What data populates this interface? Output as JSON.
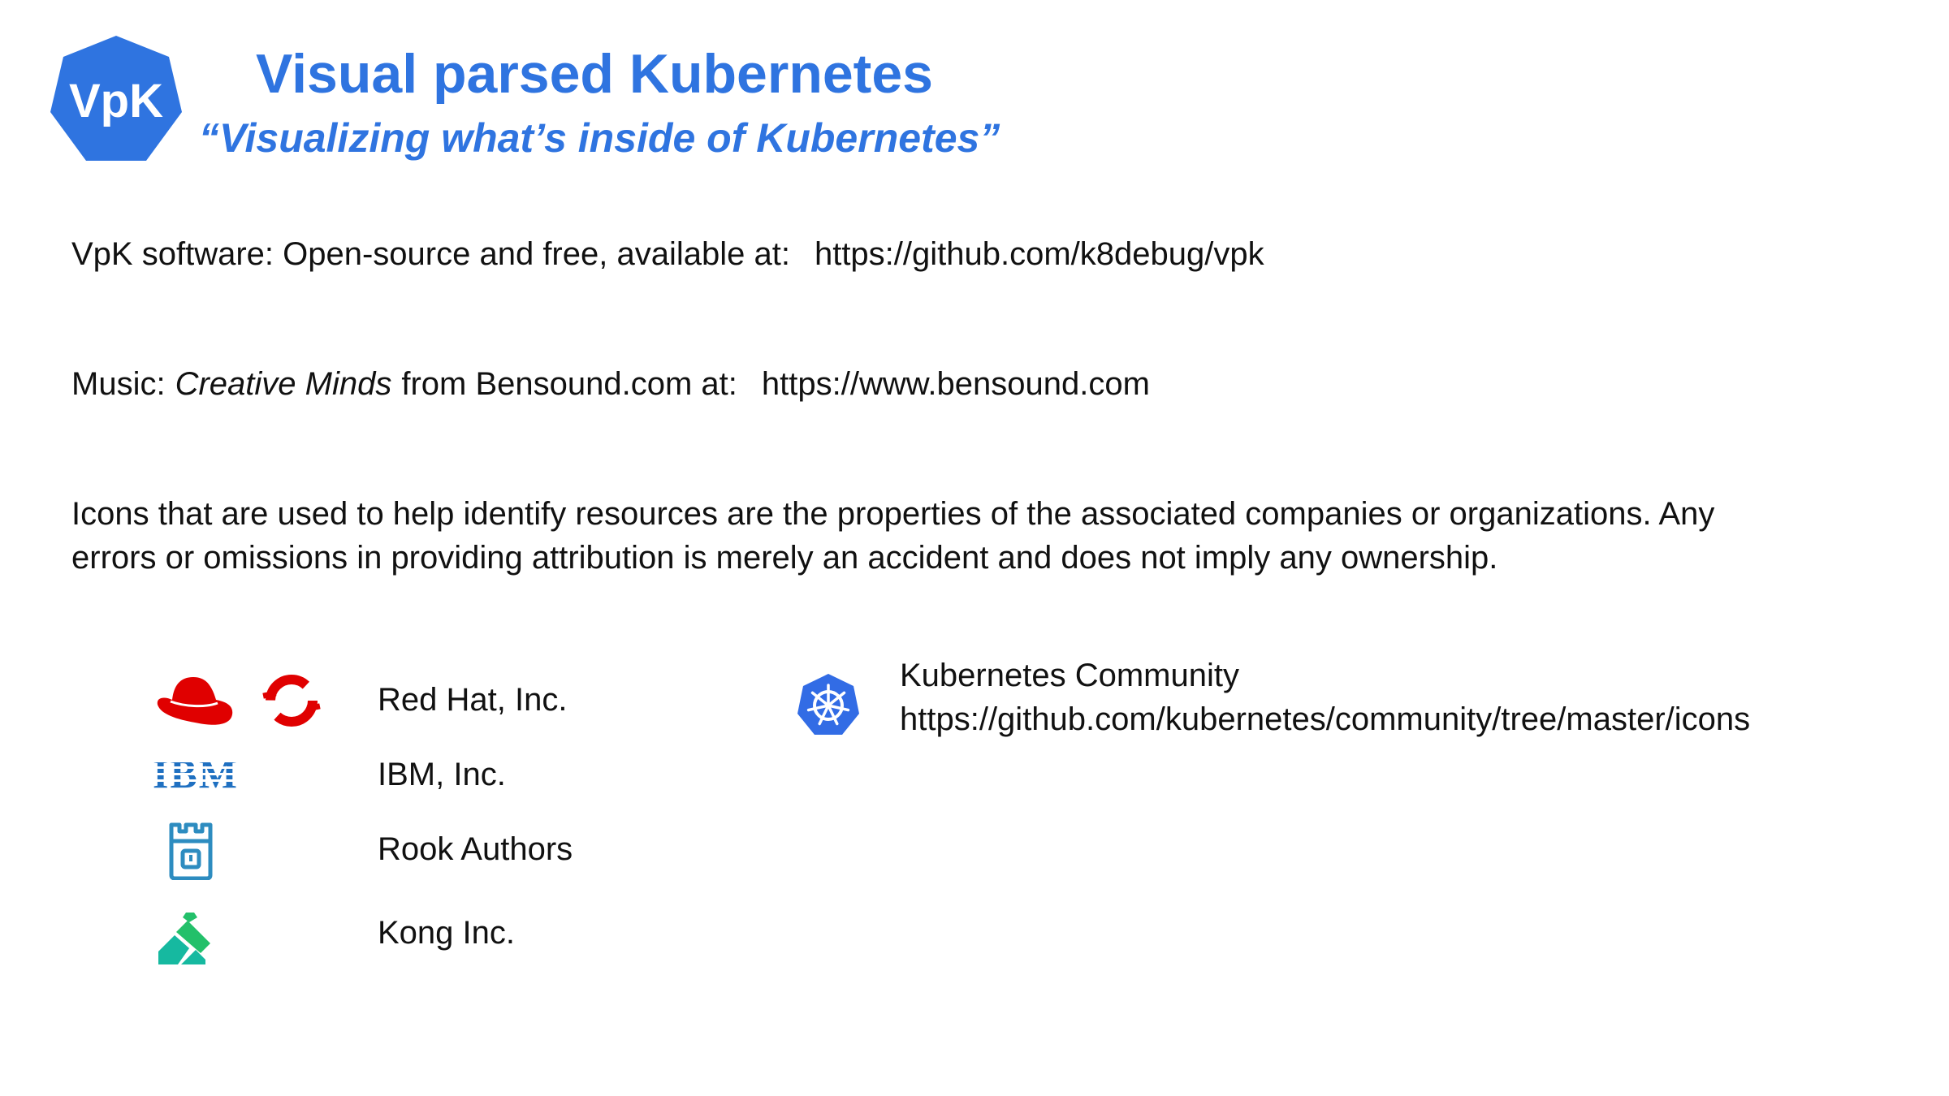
{
  "header": {
    "logo_text": "VpK",
    "title": "Visual parsed Kubernetes",
    "subtitle": "“Visualizing  what’s inside of Kubernetes”"
  },
  "software": {
    "label": "VpK software: Open-source and free, available at:",
    "url": "https://github.com/k8debug/vpk"
  },
  "music": {
    "prefix": "Music:",
    "title": "Creative Minds",
    "middle": "from Bensound.com at:",
    "url": "https://www.bensound.com"
  },
  "disclaimer": {
    "line1": "Icons that are used to help identify resources are the properties of the associated companies or organizations.  Any",
    "line2": "errors or omissions in providing attribution is merely an accident and does not imply any ownership."
  },
  "credits": [
    {
      "label": "Red Hat, Inc.",
      "icons": [
        "red-hat-icon",
        "openshift-icon"
      ]
    },
    {
      "label": "IBM, Inc.",
      "icons": [
        "ibm-icon"
      ]
    },
    {
      "label": "Rook Authors",
      "icons": [
        "rook-icon"
      ]
    },
    {
      "label": "Kong Inc.",
      "icons": [
        "kong-icon"
      ]
    }
  ],
  "kubernetes_credit": {
    "label": "Kubernetes Community",
    "url": "https://github.com/kubernetes/community/tree/master/icons",
    "icon": "kubernetes-icon"
  },
  "colors": {
    "brand_blue": "#2f74e0",
    "red_hat": "#e00000",
    "ibm": "#1f70c1",
    "rook": "#2d8cc0",
    "kong": "#16b9a0",
    "kubernetes": "#326ce5"
  }
}
